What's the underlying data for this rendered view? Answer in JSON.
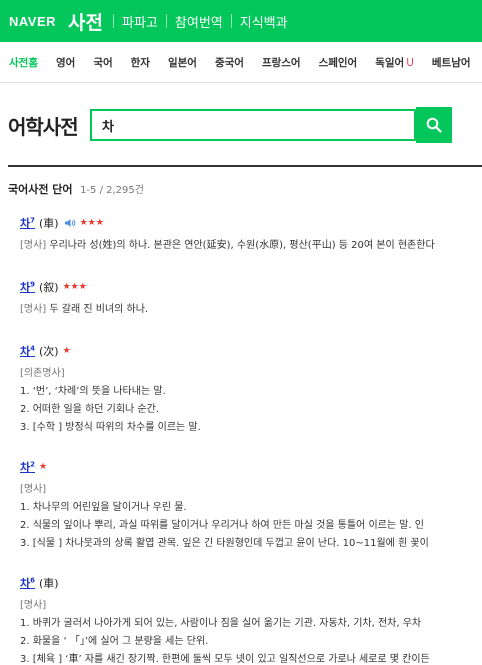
{
  "header": {
    "logo": "NAVER",
    "title": "사전",
    "links": [
      "파파고",
      "참여번역",
      "지식백과"
    ]
  },
  "tabs": [
    {
      "label": "사전홈",
      "active": true
    },
    {
      "label": "영어"
    },
    {
      "label": "국어"
    },
    {
      "label": "한자"
    },
    {
      "label": "일본어"
    },
    {
      "label": "중국어"
    },
    {
      "label": "프랑스어"
    },
    {
      "label": "스페인어"
    },
    {
      "label": "독일어",
      "badge": "U"
    },
    {
      "label": "베트남어"
    }
  ],
  "search": {
    "title": "어학사전",
    "value": "차"
  },
  "section": {
    "name": "국어사전 단어",
    "count": "1-5 / 2,295건"
  },
  "entries": [
    {
      "word": "차",
      "sup": "7",
      "hanja": "(車)",
      "audio": true,
      "stars": "★★★",
      "pos": "[명사]",
      "lines": [
        "우리나라 성(姓)의 하나. 본관은 연안(延安), 수원(水原), 평산(平山) 등 20여 본이 현존한다"
      ]
    },
    {
      "word": "차",
      "sup": "9",
      "hanja": "(叙)",
      "stars": "★★★",
      "pos": "[명사]",
      "lines": [
        "두 갈래 진 비녀의 하나."
      ]
    },
    {
      "word": "차",
      "sup": "4",
      "hanja": "(次)",
      "stars": "★",
      "pos": "[의존명사]",
      "lines": [
        "1. ‘번’, ‘차례’의 뜻을 나타내는 말.",
        "2. 어떠한 일을 하던 기회나 순간.",
        "3. [수학 ] 방정식 따위의 차수를 이르는 말."
      ]
    },
    {
      "word": "차",
      "sup": "2",
      "hanja": "",
      "stars": "★",
      "pos": "[명사]",
      "lines": [
        "1. 차나무의 어린잎을 달이거나 우린 물.",
        "2. 식물의 잎이나 뿌리, 과실 따위를 달이거나 우리거나 하여 만든 마실 것을 통틀어 이르는 말. 인",
        "3. [식물 ] 차나뭇과의 상록 활엽 관목. 잎은 긴 타원형인데 두껍고 윤이 난다. 10~11월에 흰 꽃이"
      ]
    },
    {
      "word": "차",
      "sup": "6",
      "hanja": "(車)",
      "stars": "",
      "pos": "[명사]",
      "lines": [
        "1. 바퀴가 굴러서 나아가게 되어 있는, 사람이나 짐을 실어 옮기는 기관. 자동차, 기차, 전차, 우차",
        "2. 화물을 ‘ 「」’에 실어 그 분량을 세는 단위.",
        "3. [체육 ] ‘車’ 자를 새긴 장기짝. 한편에 둘씩 모두 넷이 있고 일직선으로 가로나 세로로 몇 칸이든"
      ]
    }
  ]
}
